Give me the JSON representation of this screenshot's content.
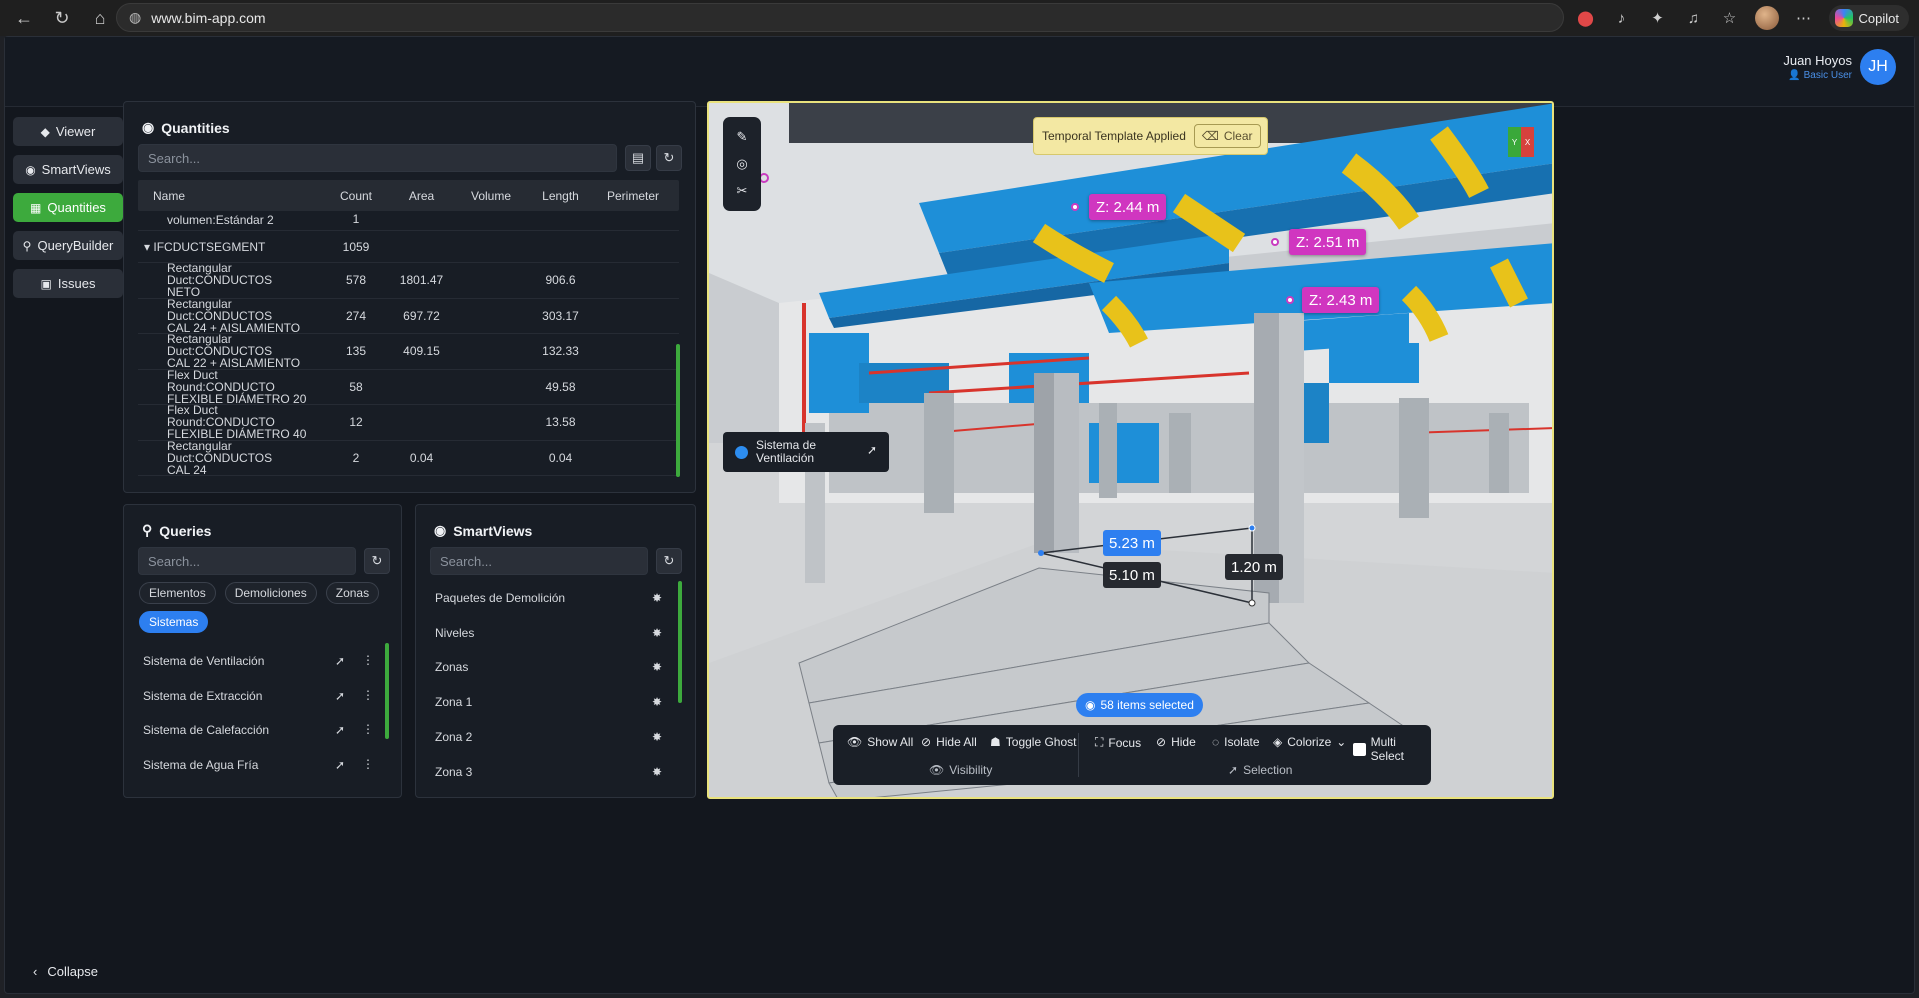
{
  "browser": {
    "url": "www.bim-app.com",
    "copilot_label": "Copilot"
  },
  "user": {
    "name": "Juan Hoyos",
    "role": "Basic User",
    "initials": "JH"
  },
  "sidebar": {
    "items": [
      {
        "label": "Viewer",
        "icon": "cube-icon"
      },
      {
        "label": "SmartViews",
        "icon": "camera-icon"
      },
      {
        "label": "Quantities",
        "icon": "table-icon"
      },
      {
        "label": "QueryBuilder",
        "icon": "search-icon"
      },
      {
        "label": "Issues",
        "icon": "chat-icon"
      }
    ],
    "active": "Quantities",
    "collapse_label": "Collapse"
  },
  "quantities": {
    "title": "Quantities",
    "search_placeholder": "Search...",
    "columns": [
      "Name",
      "Count",
      "Area",
      "Volume",
      "Length",
      "Perimeter"
    ],
    "partial_row": {
      "name": "volumen:Estándar 2",
      "count": "1"
    },
    "group": {
      "name": "IFCDUCTSEGMENT",
      "count": "1059"
    },
    "rows": [
      {
        "name1": "Rectangular Duct:CONDUCTOS",
        "name2": "NETO",
        "count": "578",
        "area": "1801.47",
        "volume": "",
        "length": "906.6",
        "perimeter": ""
      },
      {
        "name1": "Rectangular Duct:CONDUCTOS",
        "name2": "CAL 24 + AISLAMIENTO",
        "count": "274",
        "area": "697.72",
        "volume": "",
        "length": "303.17",
        "perimeter": ""
      },
      {
        "name1": "Rectangular Duct:CONDUCTOS",
        "name2": "CAL 22 + AISLAMIENTO",
        "count": "135",
        "area": "409.15",
        "volume": "",
        "length": "132.33",
        "perimeter": ""
      },
      {
        "name1": "Flex Duct Round:CONDUCTO",
        "name2": "FLEXIBLE DIÁMETRO 20",
        "count": "58",
        "area": "",
        "volume": "",
        "length": "49.58",
        "perimeter": ""
      },
      {
        "name1": "Flex Duct Round:CONDUCTO",
        "name2": "FLEXIBLE DIÁMETRO 40",
        "count": "12",
        "area": "",
        "volume": "",
        "length": "13.58",
        "perimeter": ""
      },
      {
        "name1": "Rectangular Duct:CONDUCTOS",
        "name2": "CAL 24",
        "count": "2",
        "area": "0.04",
        "volume": "",
        "length": "0.04",
        "perimeter": ""
      }
    ]
  },
  "queries": {
    "title": "Queries",
    "search_placeholder": "Search...",
    "filters": [
      "Elementos",
      "Demoliciones",
      "Zonas",
      "Sistemas"
    ],
    "active_filter": "Sistemas",
    "items": [
      "Sistema de Ventilación",
      "Sistema de Extracción",
      "Sistema de Calefacción",
      "Sistema de Agua Fría"
    ]
  },
  "smartviews": {
    "title": "SmartViews",
    "search_placeholder": "Search...",
    "items": [
      "Paquetes de Demolición",
      "Niveles",
      "Zonas",
      "Zona 1",
      "Zona 2",
      "Zona 3"
    ]
  },
  "viewer": {
    "template_text": "Temporal Template Applied",
    "clear_label": "Clear",
    "axis_y": "Y",
    "axis_x": "X",
    "z_labels": [
      "Z: 2.44 m",
      "Z: 2.51 m",
      "Z: 2.43 m"
    ],
    "dims": [
      "5.23 m",
      "5.10 m",
      "1.20 m"
    ],
    "system_card": {
      "line1": "Sistema de",
      "line2": "Ventilación"
    },
    "selected_text": "58 items selected",
    "toolbar": {
      "show_all": "Show All",
      "hide_all": "Hide All",
      "toggle_ghost": "Toggle Ghost",
      "focus": "Focus",
      "hide": "Hide",
      "isolate": "Isolate",
      "colorize": "Colorize",
      "multi_select": "Multi Select",
      "visibility_group": "Visibility",
      "selection_group": "Selection"
    },
    "colors": {
      "duct": "#1e8fd8",
      "flex": "#e8c21a",
      "pipe": "#d8342c",
      "border": "#e9e27d"
    }
  }
}
